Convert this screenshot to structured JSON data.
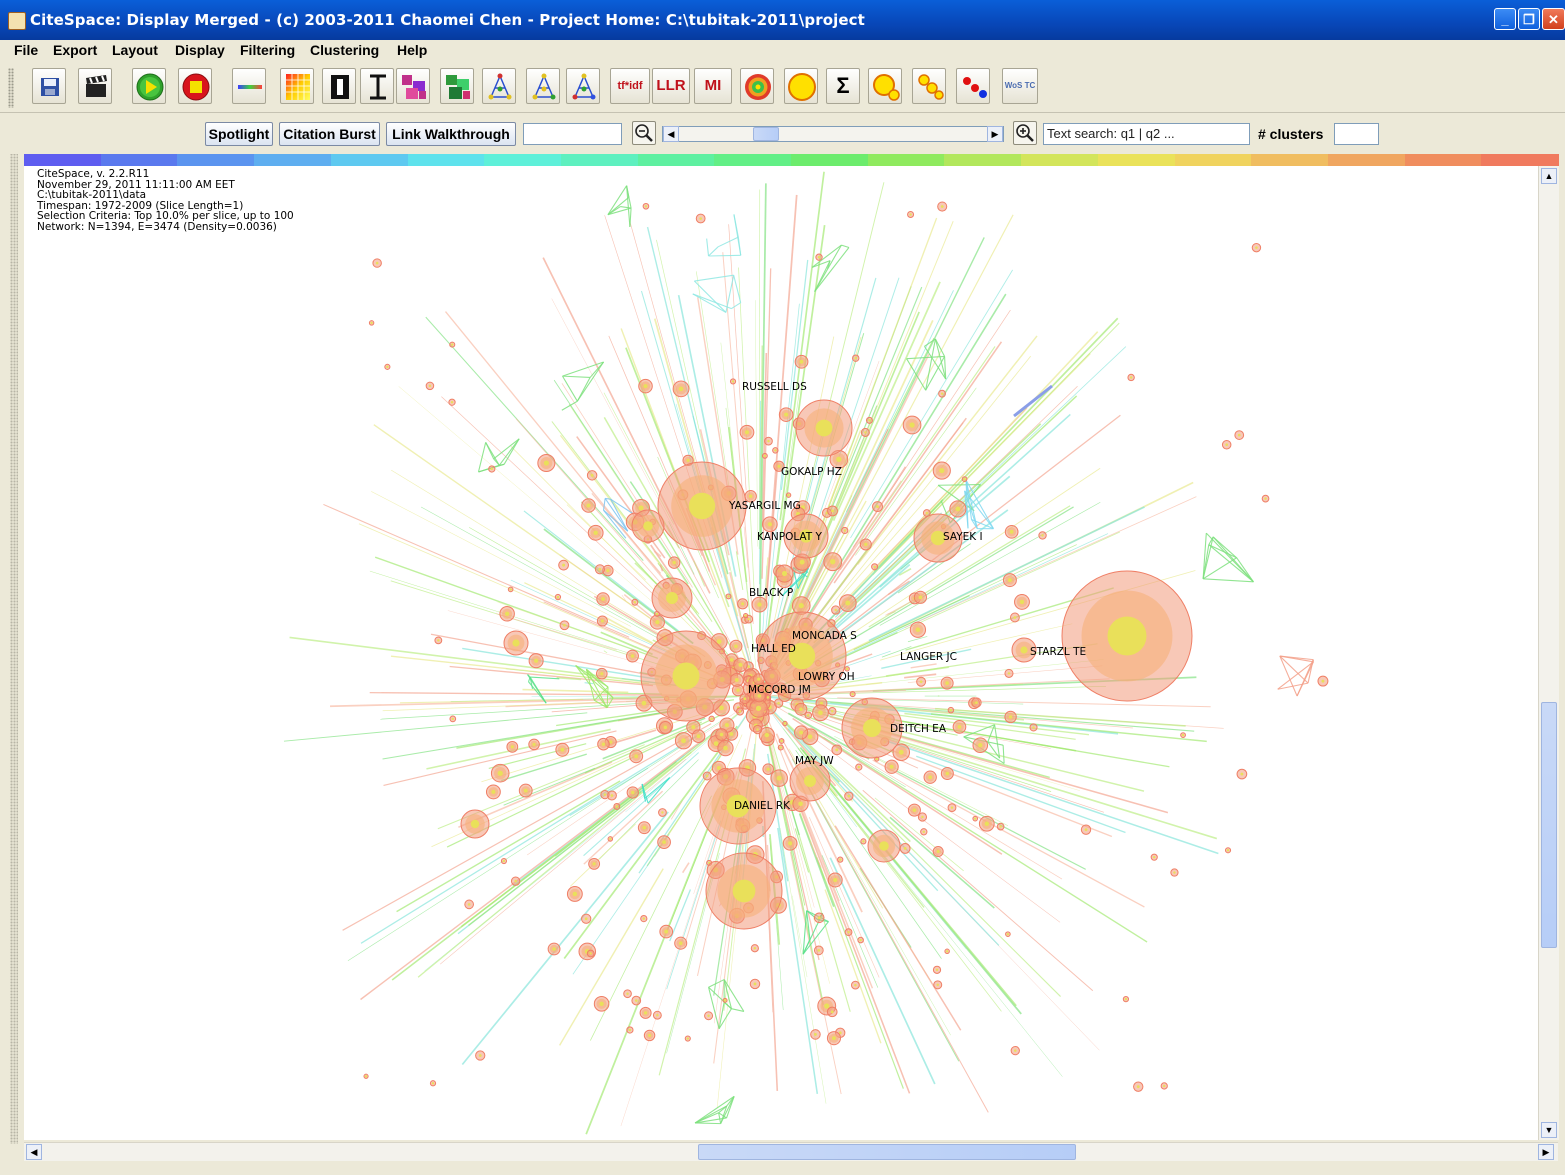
{
  "window": {
    "title": "CiteSpace: Display Merged - (c) 2003-2011 Chaomei Chen - Project Home: C:\\tubitak-2011\\project",
    "controls": [
      "minimize",
      "maximize",
      "close"
    ]
  },
  "menu": {
    "items": [
      "File",
      "Export",
      "Layout",
      "Display",
      "Filtering",
      "Clustering",
      "Help"
    ]
  },
  "toolbar": {
    "buttons": [
      {
        "name": "save-icon"
      },
      {
        "name": "movie-clapper-icon"
      },
      {
        "name": "play-icon"
      },
      {
        "name": "stop-icon"
      },
      {
        "name": "line-icon"
      },
      {
        "name": "color-grid-icon"
      },
      {
        "name": "i-beam-bold-icon"
      },
      {
        "name": "i-beam-icon"
      },
      {
        "name": "cluster-pink-icon"
      },
      {
        "name": "cluster-green-icon"
      },
      {
        "name": "tree-blue-icon"
      },
      {
        "name": "tree-yellow-icon"
      },
      {
        "name": "tree-multi-icon"
      },
      {
        "name": "tfidf",
        "label": "tf*idf"
      },
      {
        "name": "llr",
        "label": "LLR"
      },
      {
        "name": "mi",
        "label": "MI"
      },
      {
        "name": "target-rings-icon"
      },
      {
        "name": "yellow-circle-icon"
      },
      {
        "name": "sigma-icon",
        "label": "Σ"
      },
      {
        "name": "yellow-circles-icon"
      },
      {
        "name": "yellow-chain-icon"
      },
      {
        "name": "red-blue-dots-icon"
      },
      {
        "name": "wos-tc-icon",
        "label": "WoS TC"
      }
    ]
  },
  "controls": {
    "spotlight": "Spotlight",
    "citation_burst": "Citation Burst",
    "link_walkthrough": "Link Walkthrough",
    "search_placeholder": "Text search: q1 | q2 ...",
    "clusters_label": "# clusters"
  },
  "colors": {
    "year_strip": [
      "#5e5df0",
      "#5a79ee",
      "#5b94ef",
      "#5eaef0",
      "#5ec9f0",
      "#5ee2ec",
      "#5ef0d9",
      "#5ef0bf",
      "#5ef0a0",
      "#62ef86",
      "#6cec6c",
      "#8fea5e",
      "#b2e75c",
      "#d3e55b",
      "#eae25a",
      "#f0d35e",
      "#f0bd60",
      "#f0a660",
      "#f08d5e",
      "#f07a5e"
    ]
  },
  "stats": {
    "lines": [
      "CiteSpace, v. 2.2.R11",
      "November 29, 2011 11:11:00 AM EET",
      "C:\\tubitak-2011\\data",
      "Timespan: 1972-2009 (Slice Length=1)",
      "Selection Criteria: Top 10.0% per slice, up to 100",
      "Network: N=1394, E=3474 (Density=0.0036)"
    ]
  },
  "labels": [
    "RUSSELL DS",
    "GOKALP HZ",
    "YASARGIL MG",
    "KANPOLAT Y",
    "SAYEK I",
    "BLACK P",
    "MONCADA S",
    "HALL ED",
    "LANGER JC",
    "STARZL TE",
    "LOWRY OH",
    "MCCORD JM",
    "DEITCH EA",
    "MAY JW",
    "DANIEL RK"
  ]
}
